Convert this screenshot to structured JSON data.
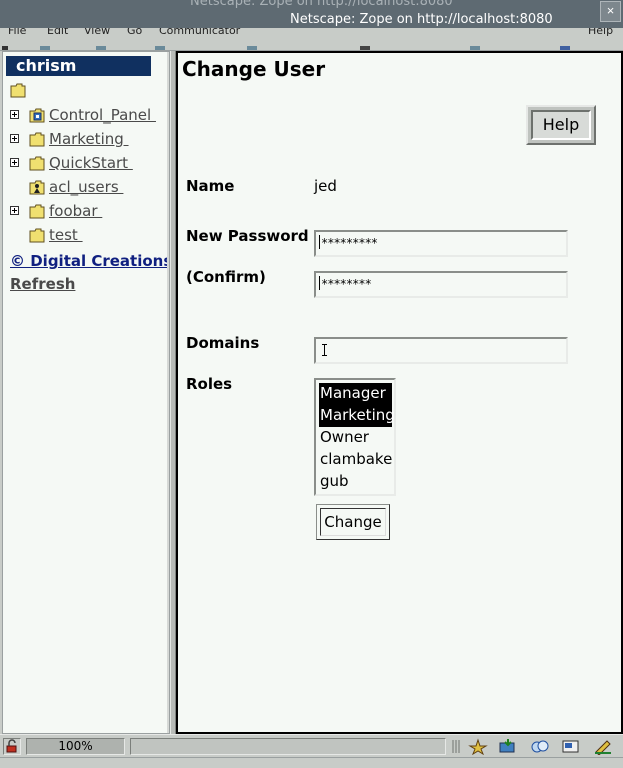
{
  "window": {
    "title": "Netscape: Zope on http://localhost:8080",
    "ghost_title": "Netscape: Zope on http://localhost:8080",
    "close_glyph": "×"
  },
  "menubar": {
    "items": [
      "File",
      "Edit",
      "View",
      "Go",
      "Communicator",
      "Help"
    ]
  },
  "sidebar": {
    "user": "chrism",
    "tree": [
      {
        "label": "Control_Panel ",
        "icon": "control-panel-icon",
        "expandable": true
      },
      {
        "label": "Marketing ",
        "icon": "folder-icon",
        "expandable": true
      },
      {
        "label": "QuickStart ",
        "icon": "folder-icon",
        "expandable": true
      },
      {
        "label": "acl_users ",
        "icon": "user-folder-icon",
        "expandable": false
      },
      {
        "label": "foobar ",
        "icon": "folder-icon",
        "expandable": true
      },
      {
        "label": "test ",
        "icon": "folder-icon",
        "expandable": false
      }
    ],
    "copyright_link": "© Digital Creations ",
    "refresh_link": "Refresh"
  },
  "main": {
    "title": "Change User",
    "help_label": "Help",
    "name_label": "Name",
    "name_value": "jed",
    "password_label": "New Password",
    "password_value": "*********",
    "confirm_label": "(Confirm)",
    "confirm_value": "********",
    "domains_label": "Domains",
    "domains_value": "",
    "roles_label": "Roles",
    "roles": [
      {
        "label": "Manager",
        "selected": true
      },
      {
        "label": "Marketing",
        "selected": true
      },
      {
        "label": "Owner",
        "selected": false
      },
      {
        "label": "clambake",
        "selected": false
      },
      {
        "label": "gub",
        "selected": false
      }
    ],
    "change_label": "Change"
  },
  "statusbar": {
    "zoom": "100%",
    "message": ""
  },
  "colors": {
    "user_banner": "#103060",
    "link_blue": "#102080",
    "frame_bg": "#f5f9f5"
  }
}
